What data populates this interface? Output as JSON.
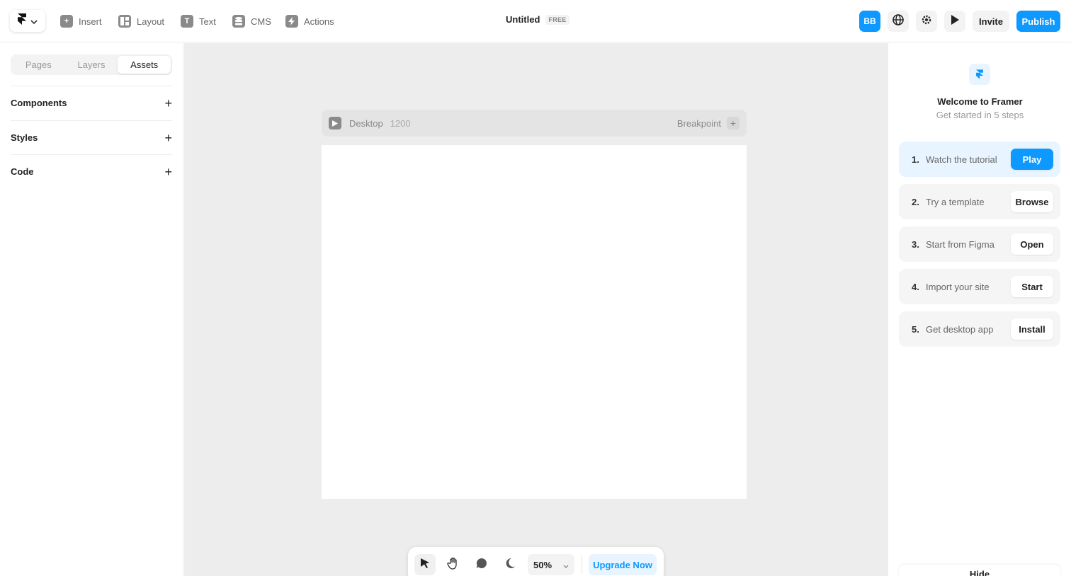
{
  "toolbar": {
    "tools": [
      {
        "label": "Insert",
        "icon": "plus-square-icon"
      },
      {
        "label": "Layout",
        "icon": "layout-icon"
      },
      {
        "label": "Text",
        "icon": "text-icon"
      },
      {
        "label": "CMS",
        "icon": "database-icon"
      },
      {
        "label": "Actions",
        "icon": "lightning-icon"
      }
    ],
    "project_title": "Untitled",
    "plan_badge": "FREE",
    "avatar_initials": "BB",
    "invite_label": "Invite",
    "publish_label": "Publish"
  },
  "left_panel": {
    "tabs": [
      {
        "label": "Pages",
        "active": false
      },
      {
        "label": "Layers",
        "active": false
      },
      {
        "label": "Assets",
        "active": true
      }
    ],
    "sections": [
      {
        "label": "Components",
        "action": "+"
      },
      {
        "label": "Styles",
        "action": "+"
      },
      {
        "label": "Code",
        "action": "+"
      }
    ]
  },
  "canvas": {
    "frame_name": "Desktop",
    "frame_width": "1200",
    "breakpoint_label": "Breakpoint",
    "breakpoint_add": "+"
  },
  "bottom_bar": {
    "zoom": "50%",
    "upgrade_label": "Upgrade Now"
  },
  "right_panel": {
    "title": "Welcome to Framer",
    "subtitle": "Get started in 5 steps",
    "steps": [
      {
        "num": "1.",
        "text": "Watch the tutorial",
        "button": "Play",
        "active": true
      },
      {
        "num": "2.",
        "text": "Try a template",
        "button": "Browse",
        "active": false
      },
      {
        "num": "3.",
        "text": "Start from Figma",
        "button": "Open",
        "active": false
      },
      {
        "num": "4.",
        "text": "Import your site",
        "button": "Start",
        "active": false
      },
      {
        "num": "5.",
        "text": "Get desktop app",
        "button": "Install",
        "active": false
      }
    ],
    "hide_label": "Hide"
  },
  "colors": {
    "accent": "#0d99ff",
    "accent_light": "#e8f4ff",
    "canvas_bg": "#ededed"
  }
}
